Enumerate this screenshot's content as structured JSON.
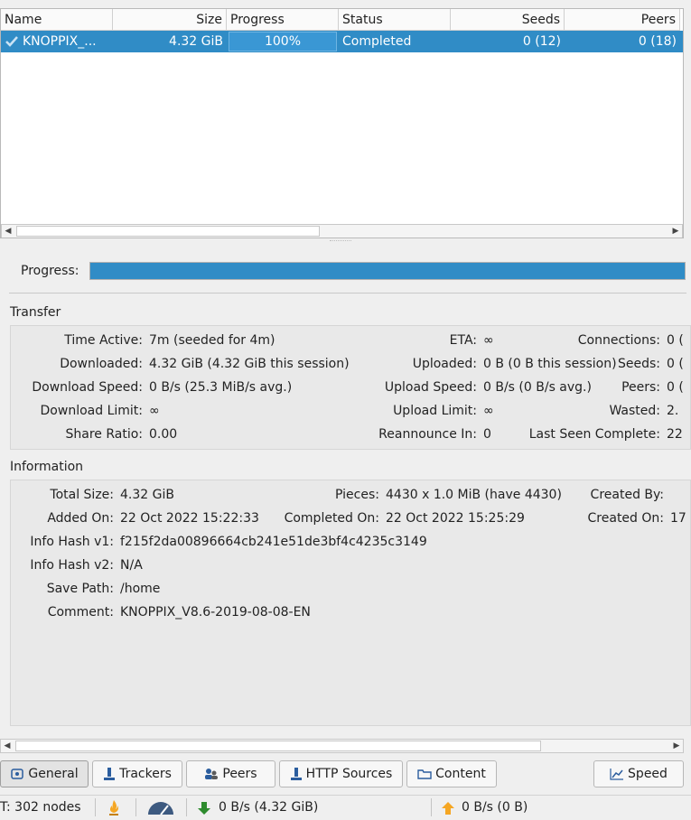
{
  "table": {
    "headers": {
      "name": "Name",
      "size": "Size",
      "progress": "Progress",
      "status": "Status",
      "seeds": "Seeds",
      "peers": "Peers"
    },
    "row": {
      "name": "KNOPPIX_...",
      "size": "4.32 GiB",
      "progress": "100%",
      "progress_fraction": 1.0,
      "status": "Completed",
      "seeds": "0 (12)",
      "peers": "0 (18)"
    }
  },
  "details": {
    "progress_label": "Progress:",
    "progress_fraction": 1.0,
    "transfer": {
      "title": "Transfer",
      "time_active_label": "Time Active:",
      "time_active": "7m (seeded for 4m)",
      "downloaded_label": "Downloaded:",
      "downloaded": "4.32 GiB (4.32 GiB this session)",
      "download_speed_label": "Download Speed:",
      "download_speed": "0 B/s (25.3 MiB/s avg.)",
      "download_limit_label": "Download Limit:",
      "download_limit": "∞",
      "share_ratio_label": "Share Ratio:",
      "share_ratio": "0.00",
      "eta_label": "ETA:",
      "eta": "∞",
      "uploaded_label": "Uploaded:",
      "uploaded": "0 B (0 B this session)",
      "upload_speed_label": "Upload Speed:",
      "upload_speed": "0 B/s (0 B/s avg.)",
      "upload_limit_label": "Upload Limit:",
      "upload_limit": "∞",
      "reannounce_label": "Reannounce In:",
      "reannounce": "0",
      "connections_label": "Connections:",
      "connections": "0 (",
      "seeds_label": "Seeds:",
      "seeds": "0 (",
      "peers_label": "Peers:",
      "peers": "0 (",
      "wasted_label": "Wasted:",
      "wasted": "2.",
      "last_seen_label": "Last Seen Complete:",
      "last_seen": "22"
    },
    "information": {
      "title": "Information",
      "total_size_label": "Total Size:",
      "total_size": "4.32 GiB",
      "added_on_label": "Added On:",
      "added_on": "22 Oct 2022 15:22:33",
      "info_hash_v1_label": "Info Hash v1:",
      "info_hash_v1": "f215f2da00896664cb241e51de3bf4c4235c3149",
      "info_hash_v2_label": "Info Hash v2:",
      "info_hash_v2": "N/A",
      "save_path_label": "Save Path:",
      "save_path": "/home",
      "comment_label": "Comment:",
      "comment": "KNOPPIX_V8.6-2019-08-08-EN",
      "pieces_label": "Pieces:",
      "pieces": "4430 x 1.0 MiB (have 4430)",
      "completed_on_label": "Completed On:",
      "completed_on": "22 Oct 2022 15:25:29",
      "created_by_label": "Created By:",
      "created_by": "",
      "created_on_label": "Created On:",
      "created_on": "17"
    }
  },
  "tabs": {
    "general": "General",
    "trackers": "Trackers",
    "peers": "Peers",
    "http_sources": "HTTP Sources",
    "content": "Content",
    "speed": "Speed"
  },
  "statusbar": {
    "dht": "T: 302 nodes",
    "download": "0 B/s (4.32 GiB)",
    "upload": "0 B/s (0 B)"
  },
  "colors": {
    "accent": "#308cc6",
    "download_arrow": "#2e8b2e",
    "upload_arrow": "#f5a623",
    "speed_gauge": "#3d5a80"
  }
}
